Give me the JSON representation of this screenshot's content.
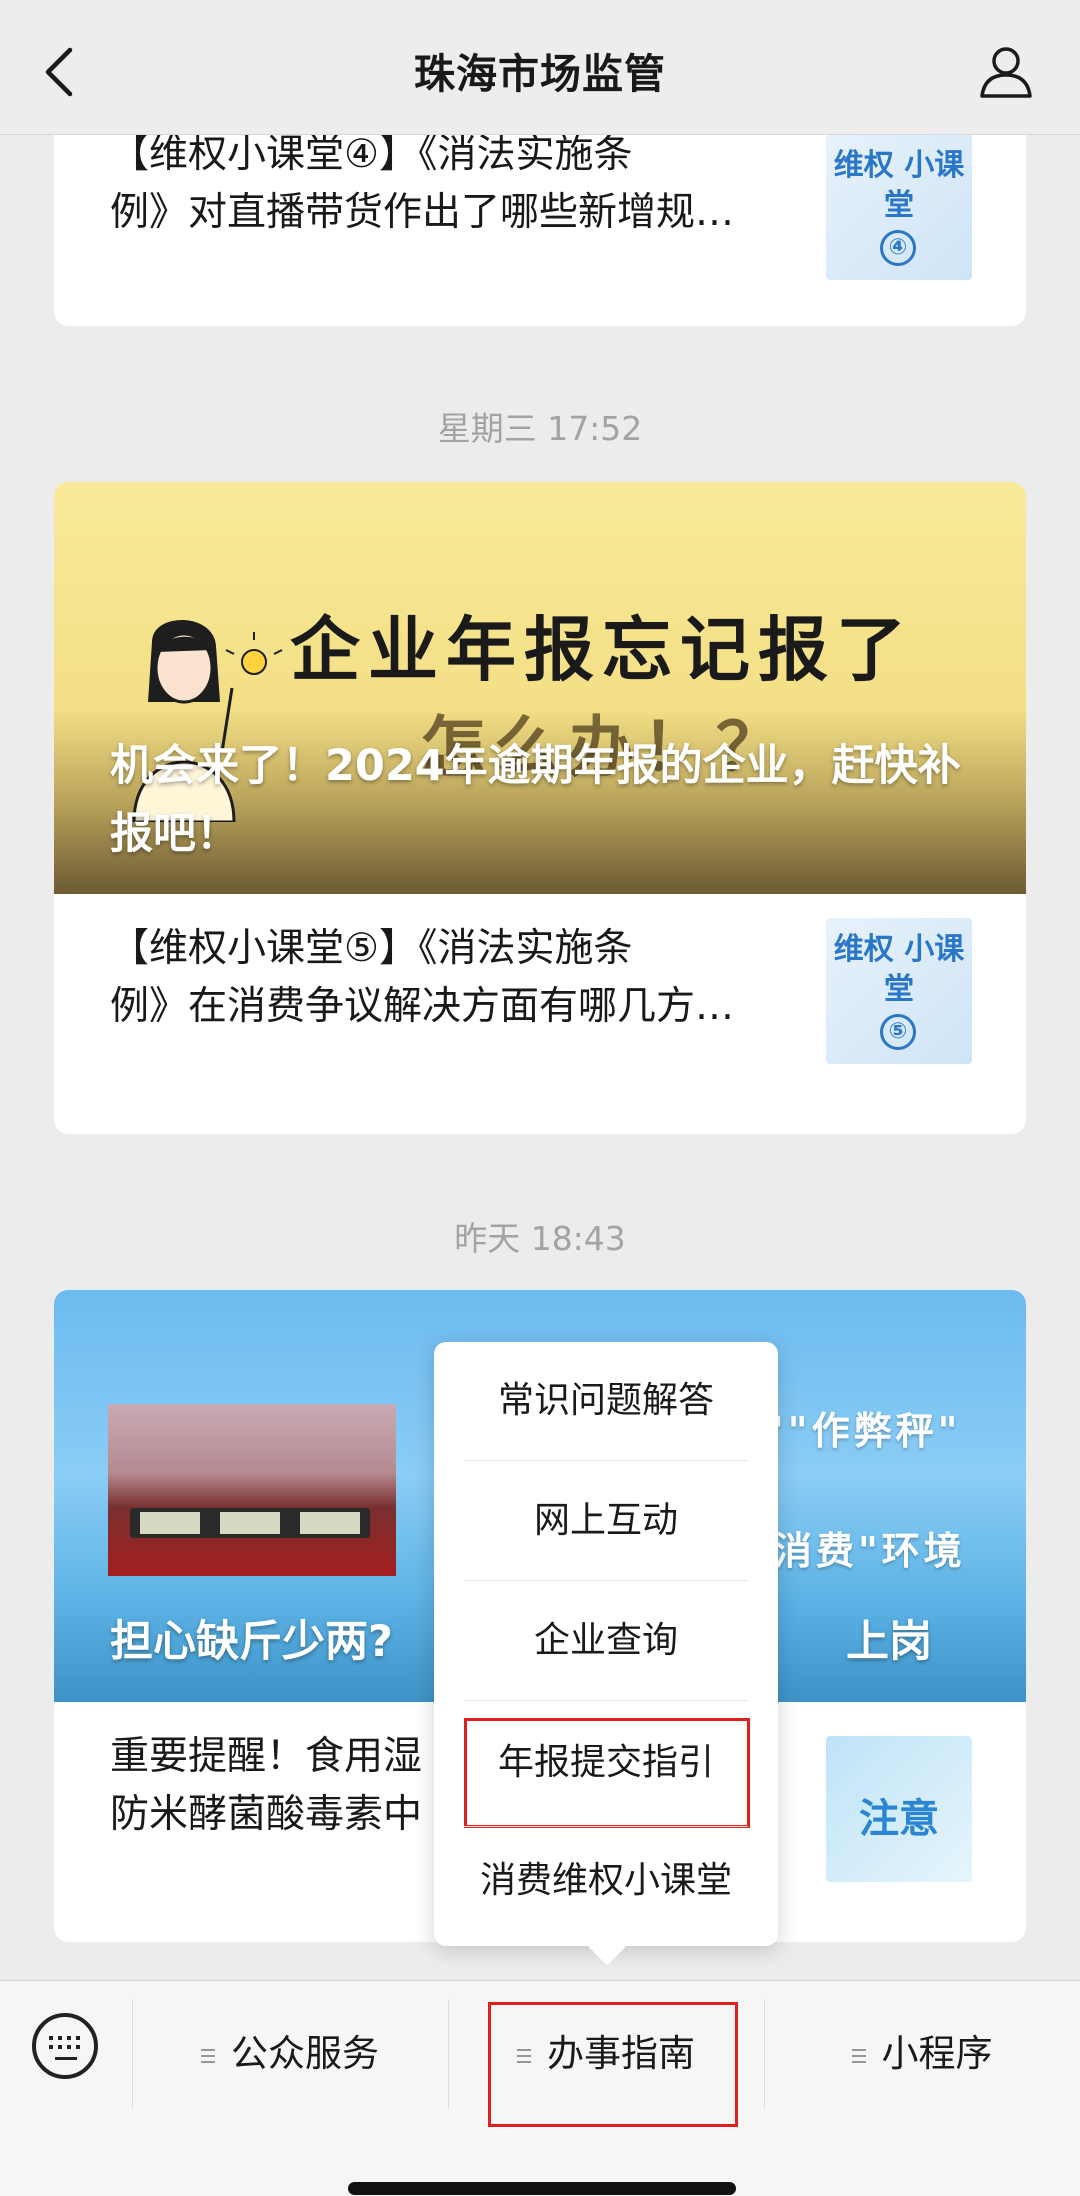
{
  "header": {
    "title": "珠海市场监管"
  },
  "articles": {
    "a1": {
      "line1": "【维权小课堂④】《消法实施条",
      "line2": "例》对直播带货作出了哪些新增规…",
      "thumb_title": "维权 小课堂",
      "thumb_num": "④"
    },
    "ts1": "星期三 17:52",
    "banner1": {
      "headline1": "企业年报忘记报了",
      "headline2": "怎么办！？",
      "caption": "机会来了！2024年逾期年报的企业，赶快补报吧！"
    },
    "a2": {
      "line1": "【维权小课堂⑤】《消法实施条",
      "line2": "例》在消费争议解决方面有哪几方…",
      "thumb_title": "维权 小课堂",
      "thumb_num": "⑤"
    },
    "ts2": "昨天 18:43",
    "banner2": {
      "caption": "担心缺斤少两?",
      "caption_tail": "上岗",
      "text_right1": "\"\"作弊秤\"",
      "text_right2": "消费\"环境"
    },
    "a3": {
      "line1": "重要提醒！食用湿",
      "line2": "防米酵菌酸毒素中",
      "thumb_title": "注意"
    }
  },
  "popup_menu": {
    "items": [
      "常识问题解答",
      "网上互动",
      "企业查询",
      "年报提交指引",
      "消费维权小课堂"
    ],
    "highlighted": "年报提交指引"
  },
  "bottom_bar": {
    "keyboard_icon": "keyboard-icon",
    "menus": [
      "公众服务",
      "办事指南",
      "小程序"
    ],
    "highlighted": "办事指南"
  },
  "colors": {
    "highlight_red": "#e02020",
    "accent_blue": "#2a77c7"
  }
}
